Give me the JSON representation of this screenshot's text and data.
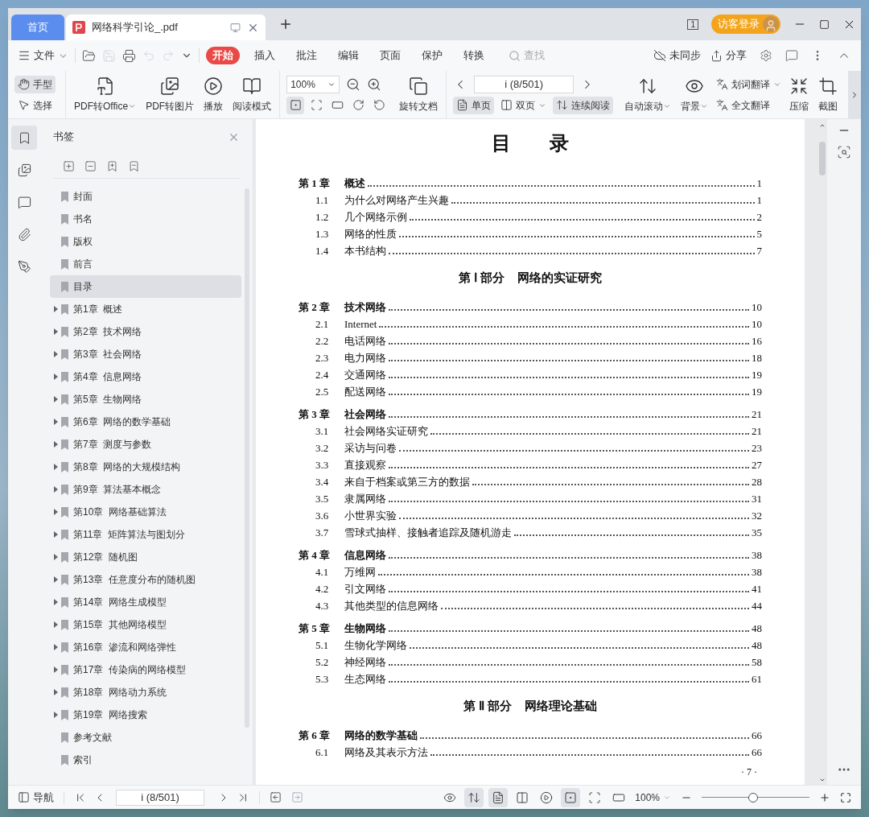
{
  "window": {
    "tabs": [
      {
        "kind": "home",
        "label": "首页",
        "selected": false
      },
      {
        "kind": "file",
        "label": "网络科学引论_.pdf",
        "selected": true
      }
    ],
    "window_count": "1",
    "login_button": "访客登录"
  },
  "menu": {
    "file": "文件",
    "tabs": [
      {
        "label": "开始",
        "selected": true
      },
      {
        "label": "插入",
        "selected": false
      },
      {
        "label": "批注",
        "selected": false
      },
      {
        "label": "编辑",
        "selected": false
      },
      {
        "label": "页面",
        "selected": false
      },
      {
        "label": "保护",
        "selected": false
      },
      {
        "label": "转换",
        "selected": false
      }
    ],
    "search": {
      "placeholder": "查找"
    },
    "sync": "未同步",
    "share": "分享"
  },
  "toolbar": {
    "items": [
      {
        "kind": "tools",
        "buttons": [
          {
            "kind": "hand",
            "label": "手型",
            "selected": true
          },
          {
            "kind": "pointer",
            "label": "选择",
            "selected": false
          }
        ]
      },
      {
        "kind": "office",
        "label": "PDF转Office",
        "dropdown": true
      },
      {
        "kind": "picture",
        "label": "PDF转图片",
        "dropdown": false
      },
      {
        "kind": "play",
        "label": "播放",
        "dropdown": false
      },
      {
        "kind": "book",
        "label": "阅读模式",
        "dropdown": false
      },
      {
        "kind": "zoom",
        "value": "100%",
        "views": [
          {
            "kind": "actual-size",
            "selected": true
          },
          {
            "kind": "fit-page",
            "selected": false
          },
          {
            "kind": "fit-width",
            "selected": false
          },
          {
            "kind": "rotate-right",
            "selected": false
          },
          {
            "kind": "rotate-left",
            "selected": false
          }
        ]
      },
      {
        "kind": "rotate-doc",
        "label": "旋转文档",
        "dropdown": false
      },
      {
        "kind": "nav",
        "value": "i (8/501)",
        "modes": [
          {
            "kind": "single",
            "label": "单页",
            "selected": true,
            "dropdown": false
          },
          {
            "kind": "double",
            "label": "双页",
            "selected": false,
            "dropdown": true
          },
          {
            "kind": "continuous",
            "label": "连续阅读",
            "selected": true,
            "dropdown": false
          }
        ]
      },
      {
        "kind": "auto-scroll",
        "label": "自动滚动",
        "dropdown": true
      },
      {
        "kind": "eye",
        "label": "背景",
        "dropdown": true
      },
      {
        "kind": "translate",
        "buttons": [
          {
            "label": "划词翻译",
            "dropdown": true
          },
          {
            "label": "全文翻译",
            "dropdown": false
          }
        ]
      },
      {
        "kind": "compress",
        "label": "压缩",
        "dropdown": false
      },
      {
        "kind": "crop",
        "label": "截图",
        "dropdown": false
      }
    ]
  },
  "sidebar": {
    "rail": [
      {
        "kind": "bookmark",
        "selected": true
      },
      {
        "kind": "picture",
        "selected": false
      },
      {
        "kind": "comment",
        "selected": false
      },
      {
        "kind": "clip",
        "selected": false
      },
      {
        "kind": "pen",
        "selected": false
      }
    ],
    "title": "书签",
    "items": [
      {
        "kind": "leaf",
        "label": "封面",
        "selected": false
      },
      {
        "kind": "leaf",
        "label": "书名",
        "selected": false
      },
      {
        "kind": "leaf",
        "label": "版权",
        "selected": false
      },
      {
        "kind": "leaf",
        "label": "前言",
        "selected": false
      },
      {
        "kind": "leaf",
        "label": "目录",
        "selected": true
      },
      {
        "kind": "chapter",
        "label": "第1章  概述",
        "selected": false
      },
      {
        "kind": "chapter",
        "label": "第2章  技术网络",
        "selected": false
      },
      {
        "kind": "chapter",
        "label": "第3章  社会网络",
        "selected": false
      },
      {
        "kind": "chapter",
        "label": "第4章  信息网络",
        "selected": false
      },
      {
        "kind": "chapter",
        "label": "第5章  生物网络",
        "selected": false
      },
      {
        "kind": "chapter",
        "label": "第6章  网络的数学基础",
        "selected": false
      },
      {
        "kind": "chapter",
        "label": "第7章  测度与参数",
        "selected": false
      },
      {
        "kind": "chapter",
        "label": "第8章  网络的大规模结构",
        "selected": false
      },
      {
        "kind": "chapter",
        "label": "第9章  算法基本概念",
        "selected": false
      },
      {
        "kind": "chapter",
        "label": "第10章  网络基础算法",
        "selected": false
      },
      {
        "kind": "chapter",
        "label": "第11章  矩阵算法与图划分",
        "selected": false
      },
      {
        "kind": "chapter",
        "label": "第12章  随机图",
        "selected": false
      },
      {
        "kind": "chapter",
        "label": "第13章  任意度分布的随机图",
        "selected": false
      },
      {
        "kind": "chapter",
        "label": "第14章  网络生成模型",
        "selected": false
      },
      {
        "kind": "chapter",
        "label": "第15章  其他网络模型",
        "selected": false
      },
      {
        "kind": "chapter",
        "label": "第16章  渗流和网络弹性",
        "selected": false
      },
      {
        "kind": "chapter",
        "label": "第17章  传染病的网络模型",
        "selected": false
      },
      {
        "kind": "chapter",
        "label": "第18章  网络动力系统",
        "selected": false
      },
      {
        "kind": "chapter",
        "label": "第19章  网络搜索",
        "selected": false
      },
      {
        "kind": "leaf",
        "label": "参考文献",
        "selected": false
      },
      {
        "kind": "leaf",
        "label": "索引",
        "selected": false
      }
    ]
  },
  "document": {
    "title": "目　　录",
    "entries": [
      {
        "kind": "chapter",
        "number": "第 1 章",
        "title": "概述",
        "page": "1"
      },
      {
        "kind": "section",
        "number": "1.1",
        "title": "为什么对网络产生兴趣",
        "page": "1"
      },
      {
        "kind": "section",
        "number": "1.2",
        "title": "几个网络示例",
        "page": "2"
      },
      {
        "kind": "section",
        "number": "1.3",
        "title": "网络的性质",
        "page": "5"
      },
      {
        "kind": "section",
        "number": "1.4",
        "title": "本书结构",
        "page": "7"
      },
      {
        "kind": "part",
        "number": "第 Ⅰ 部分",
        "title": "网络的实证研究"
      },
      {
        "kind": "chapter",
        "number": "第 2 章",
        "title": "技术网络",
        "page": "10"
      },
      {
        "kind": "section",
        "number": "2.1",
        "title": "Internet",
        "page": "10"
      },
      {
        "kind": "section",
        "number": "2.2",
        "title": "电话网络",
        "page": "16"
      },
      {
        "kind": "section",
        "number": "2.3",
        "title": "电力网络",
        "page": "18"
      },
      {
        "kind": "section",
        "number": "2.4",
        "title": "交通网络",
        "page": "19"
      },
      {
        "kind": "section",
        "number": "2.5",
        "title": "配送网络",
        "page": "19"
      },
      {
        "kind": "chapter",
        "number": "第 3 章",
        "title": "社会网络",
        "page": "21"
      },
      {
        "kind": "section",
        "number": "3.1",
        "title": "社会网络实证研究",
        "page": "21"
      },
      {
        "kind": "section",
        "number": "3.2",
        "title": "采访与问卷",
        "page": "23"
      },
      {
        "kind": "section",
        "number": "3.3",
        "title": "直接观察",
        "page": "27"
      },
      {
        "kind": "section",
        "number": "3.4",
        "title": "来自于档案或第三方的数据",
        "page": "28"
      },
      {
        "kind": "section",
        "number": "3.5",
        "title": "隶属网络",
        "page": "31"
      },
      {
        "kind": "section",
        "number": "3.6",
        "title": "小世界实验",
        "page": "32"
      },
      {
        "kind": "section",
        "number": "3.7",
        "title": "雪球式抽样、接触者追踪及随机游走",
        "page": "35"
      },
      {
        "kind": "chapter",
        "number": "第 4 章",
        "title": "信息网络",
        "page": "38"
      },
      {
        "kind": "section",
        "number": "4.1",
        "title": "万维网",
        "page": "38"
      },
      {
        "kind": "section",
        "number": "4.2",
        "title": "引文网络",
        "page": "41"
      },
      {
        "kind": "section",
        "number": "4.3",
        "title": "其他类型的信息网络",
        "page": "44"
      },
      {
        "kind": "chapter",
        "number": "第 5 章",
        "title": "生物网络",
        "page": "48"
      },
      {
        "kind": "section",
        "number": "5.1",
        "title": "生物化学网络",
        "page": "48"
      },
      {
        "kind": "section",
        "number": "5.2",
        "title": "神经网络",
        "page": "58"
      },
      {
        "kind": "section",
        "number": "5.3",
        "title": "生态网络",
        "page": "61"
      },
      {
        "kind": "part",
        "number": "第 Ⅱ 部分",
        "title": "网络理论基础"
      },
      {
        "kind": "chapter",
        "number": "第 6 章",
        "title": "网络的数学基础",
        "page": "66"
      },
      {
        "kind": "section",
        "number": "6.1",
        "title": "网络及其表示方法",
        "page": "66"
      }
    ],
    "page_number": "· 7 ·"
  },
  "status_bar": {
    "nav_button": "导航",
    "page_value": "i (8/501)",
    "views": [
      {
        "kind": "eye",
        "selected": false
      },
      {
        "kind": "continuous",
        "selected": true
      },
      {
        "kind": "single",
        "selected": true
      },
      {
        "kind": "double",
        "selected": false
      },
      {
        "kind": "play",
        "selected": false
      },
      {
        "kind": "actual-size",
        "selected": true
      },
      {
        "kind": "fit-page",
        "selected": false
      },
      {
        "kind": "fit-width",
        "selected": false
      }
    ],
    "zoom_value": "100%",
    "zoom_slider": {
      "level": 0.48
    }
  }
}
